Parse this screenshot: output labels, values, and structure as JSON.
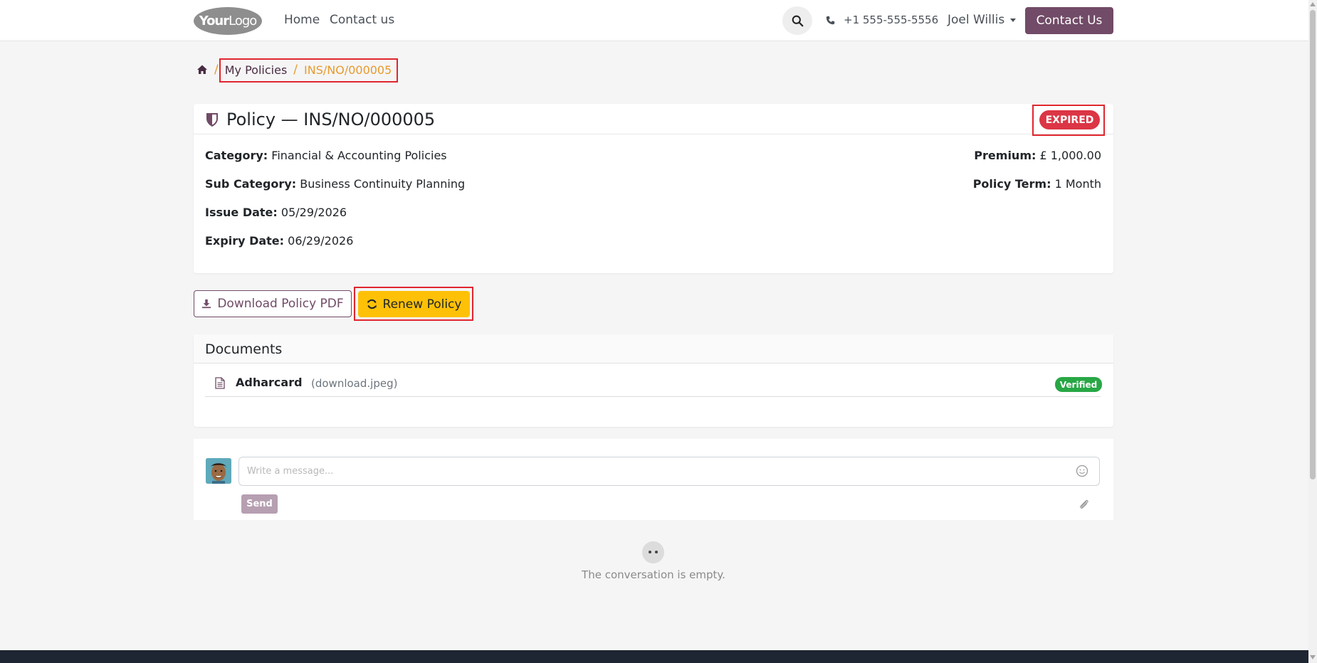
{
  "header": {
    "logo_your": "Your",
    "logo_logo": "Logo",
    "nav": [
      {
        "label": "Home"
      },
      {
        "label": "Contact us"
      }
    ],
    "phone": "+1 555-555-5556",
    "user_name": "Joel Willis",
    "contact_button": "Contact Us"
  },
  "breadcrumb": {
    "sep": "/",
    "items": [
      {
        "label": "My Policies"
      },
      {
        "label": "INS/NO/000005"
      }
    ]
  },
  "policy": {
    "title": "Policy — INS/NO/000005",
    "status": "EXPIRED",
    "status_color": "#dc3545",
    "fields_left": [
      {
        "label": "Category:",
        "value": "Financial & Accounting Policies"
      },
      {
        "label": "Sub Category:",
        "value": "Business Continuity Planning"
      },
      {
        "label": "Issue Date:",
        "value": "05/29/2026"
      },
      {
        "label": "Expiry Date:",
        "value": "06/29/2026"
      }
    ],
    "fields_right": [
      {
        "label": "Premium:",
        "value": "£ 1,000.00"
      },
      {
        "label": "Policy Term:",
        "value": "1 Month"
      }
    ]
  },
  "actions": {
    "download_label": "Download Policy PDF",
    "renew_label": "Renew Policy",
    "accent": "#714b67",
    "renew_color": "#ffc107"
  },
  "documents": {
    "title": "Documents",
    "items": [
      {
        "name": "Adharcard",
        "file": "(download.jpeg)",
        "status": "Verified"
      }
    ]
  },
  "chatter": {
    "placeholder": "Write a message...",
    "send_label": "Send",
    "empty_text": "The conversation is empty."
  }
}
